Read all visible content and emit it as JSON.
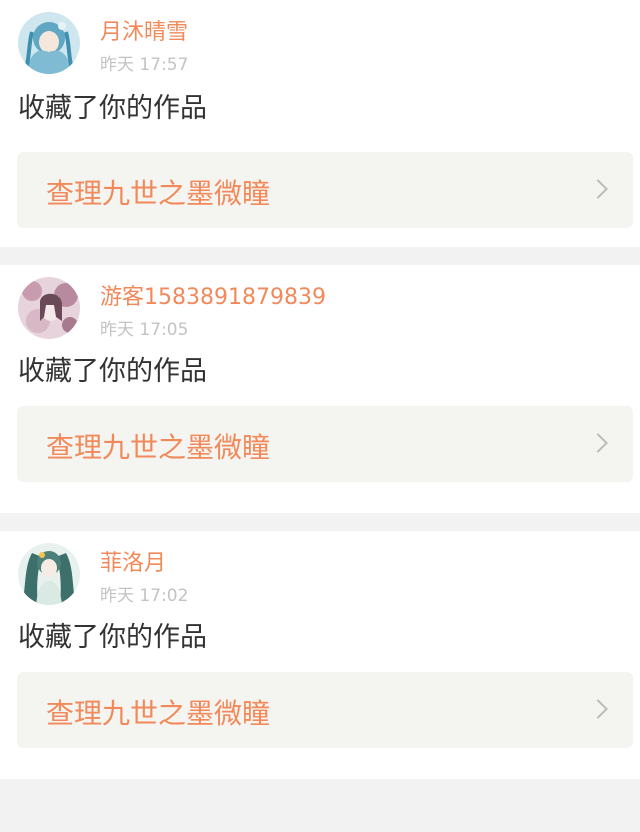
{
  "activities": [
    {
      "username": "月沐晴雪",
      "time": "昨天 17:57",
      "action": "收藏了你的作品",
      "work_title": "查理九世之墨微瞳",
      "avatar_icon": "anime-girl-avatar-blue"
    },
    {
      "username": "游客1583891879839",
      "time": "昨天 17:05",
      "action": "收藏了你的作品",
      "work_title": "查理九世之墨微瞳",
      "avatar_icon": "anime-girl-avatar-pink"
    },
    {
      "username": "菲洛月",
      "time": "昨天 17:02",
      "action": "收藏了你的作品",
      "work_title": "查理九世之墨微瞳",
      "avatar_icon": "anime-girl-avatar-teal"
    }
  ],
  "colors": {
    "accent": "#f2895a",
    "muted": "#c3c3c3",
    "text": "#333333",
    "link_bg": "#f4f4f0",
    "page_bg": "#f2f2f2"
  }
}
